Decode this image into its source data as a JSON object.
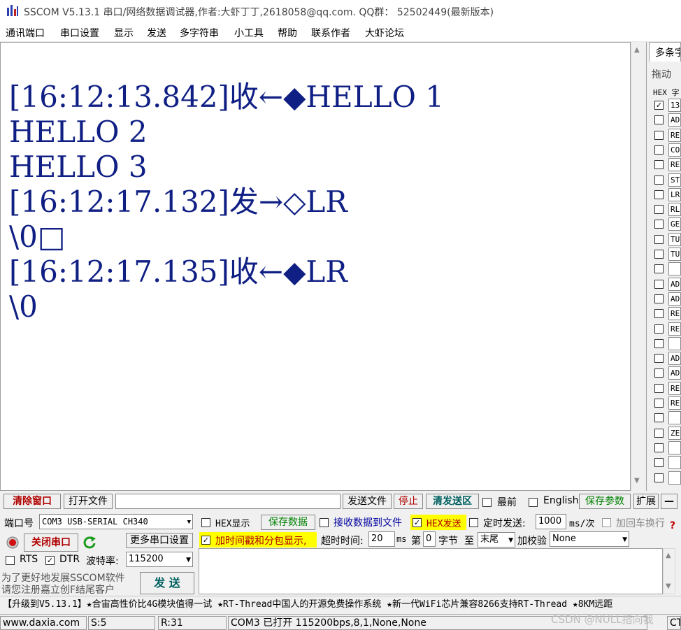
{
  "title": {
    "text": "SSCOM V5.13.1 串口/网络数据调试器,作者:大虾丁丁,2618058@qq.com. QQ群： 52502449(最新版本)"
  },
  "menu": [
    "通讯端口",
    "串口设置",
    "显示",
    "发送",
    "多字符串",
    "小工具",
    "帮助",
    "联系作者",
    "大虾论坛"
  ],
  "receive": {
    "lines": [
      "[16:12:13.842]收←◆HELLO 1",
      "HELLO 2",
      "HELLO 3",
      "[16:12:17.132]发→◇LR",
      "\\0□",
      "[16:12:17.135]收←◆LR",
      "\\0"
    ]
  },
  "multistring": {
    "tab_label": "多条字",
    "group_label": "拖动",
    "header": "HEX 字",
    "items": [
      "13",
      "AD",
      "RE",
      "CO",
      "RE",
      "ST",
      "LR",
      "RL",
      "GE",
      "TU",
      "TU",
      "",
      "AD",
      "AD",
      "RE",
      "RE",
      "",
      "AD",
      "AD",
      "RE",
      "RE",
      "",
      "ZE",
      "",
      "",
      ""
    ],
    "checked_first": "✓"
  },
  "toolbar1": {
    "clear_window": "清除窗口",
    "open_file": "打开文件",
    "file_path": "",
    "send_file": "发送文件",
    "stop": "停止",
    "clear_send": "清发送区",
    "topmost": "最前",
    "english": "English",
    "save_params": "保存参数",
    "expand": "扩展",
    "collapse": "—"
  },
  "port": {
    "port_label": "端口号",
    "port_value": "COM3 USB-SERIAL CH340",
    "close_port": "关闭串口",
    "more_settings": "更多串口设置",
    "rts": "RTS",
    "dtr": "DTR",
    "baud_label": "波特率:",
    "baud_value": "115200",
    "promo_line1": "为了更好地发展SSCOM软件",
    "promo_line2": "请您注册嘉立创F结尾客户",
    "send_button": "发 送"
  },
  "options": {
    "hex_display": "HEX显示",
    "save_data": "保存数据",
    "recv_to_file": "接收数据到文件",
    "hex_send": "HEX发送",
    "timed_send": "定时发送:",
    "interval": "1000",
    "interval_unit": "ms/次",
    "append_newline": "加回车换行",
    "timestamp": "加时间戳和分包显示,",
    "timeout_label": "超时时间:",
    "timeout_value": "20",
    "ms": "ms",
    "nth_label": "第",
    "nth_value": "0",
    "byte_label": "字节",
    "to_label": "至",
    "end_value": "末尾",
    "checksum_label": "加校验",
    "checksum_value": "None",
    "help": "?",
    "check": "✓"
  },
  "send": {
    "content": ""
  },
  "marquee": "【升级到V5.13.1】★合宙高性价比4G模块值得一试 ★RT-Thread中国人的开源免费操作系统 ★新一代WiFi芯片兼容8266支持RT-Thread ★8KM远距",
  "status": {
    "website": "www.daxia.com",
    "sent": "S:5",
    "received": "R:31",
    "port_status": "COM3 已打开  115200bps,8,1,None,None",
    "cts": "CTS",
    "watermark": "CSDN @NULL指向我"
  },
  "colors": {
    "receive_text": "#0f1f84",
    "red_label": "#b00000",
    "green_label": "#008000",
    "highlight": "#ffff00"
  }
}
